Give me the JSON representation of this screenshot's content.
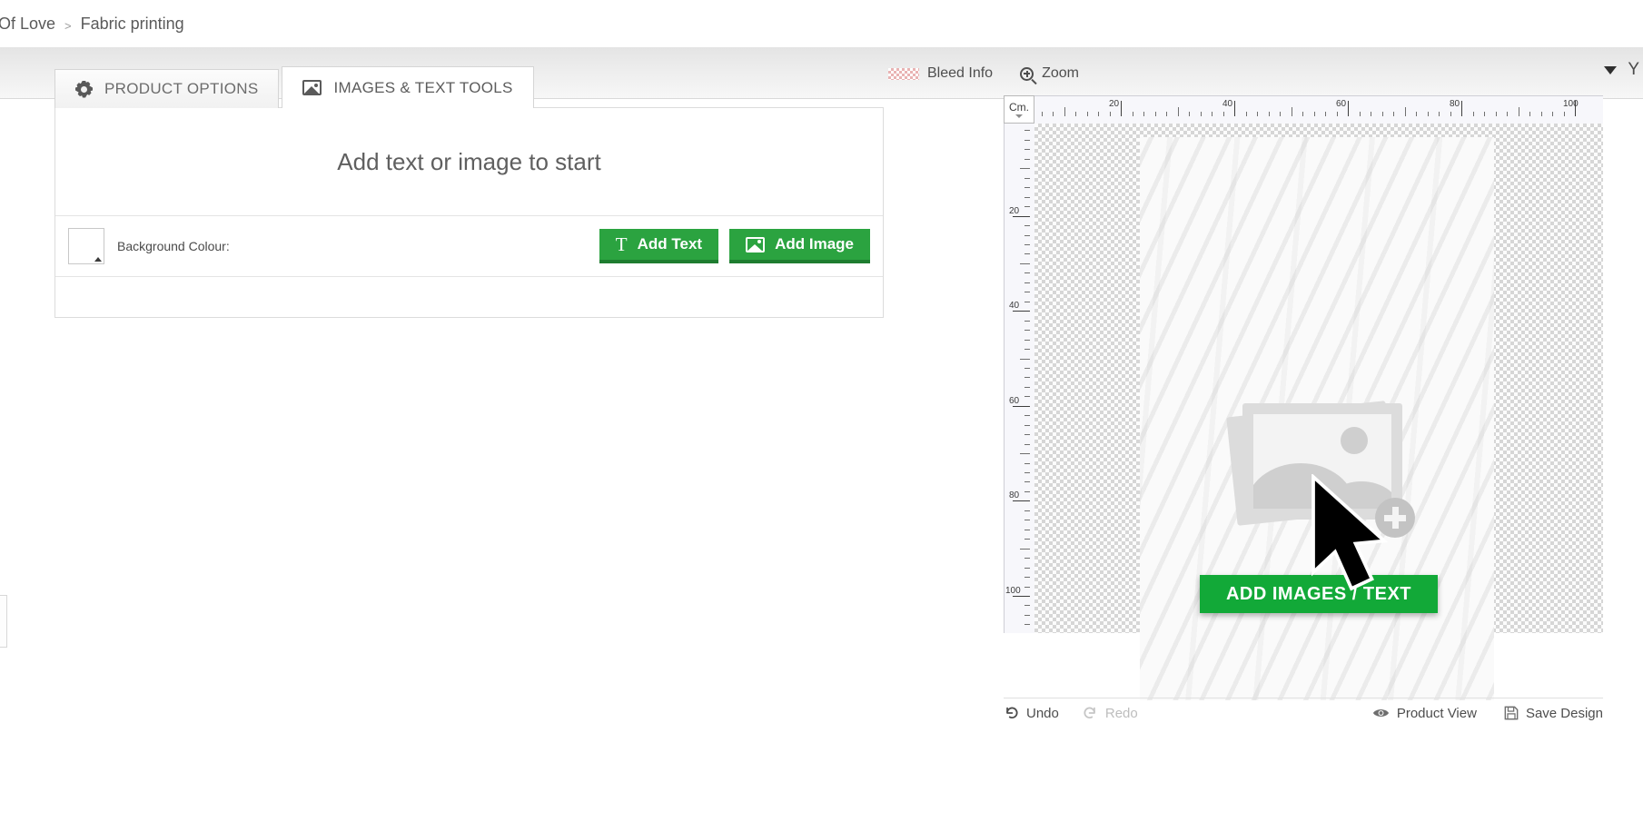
{
  "breadcrumb": {
    "items": [
      {
        "label": "s Of Love"
      },
      {
        "label": "Fabric printing"
      }
    ],
    "separator": ">"
  },
  "tabs": [
    {
      "label": "PRODUCT OPTIONS",
      "icon": "gear-icon",
      "active": false
    },
    {
      "label": "IMAGES & TEXT TOOLS",
      "icon": "picture-icon",
      "active": true
    }
  ],
  "editor_panel": {
    "hint": "Add text or image to start",
    "background_colour_label": "Background Colour:",
    "background_colour_value": "#ffffff",
    "buttons": [
      {
        "label": "Add Text",
        "icon": "text-T-icon"
      },
      {
        "label": "Add Image",
        "icon": "picture-icon"
      }
    ]
  },
  "right_tools": [
    {
      "label": "Bleed Info",
      "icon": "bleed-checker-swatch"
    },
    {
      "label": "Zoom",
      "icon": "magnifier-plus-icon"
    }
  ],
  "right_edge": {
    "caret": "collapse-caret-icon",
    "letter": "Y"
  },
  "stage": {
    "ruler_unit": "Cm.",
    "ruler_h_labels": [
      "20",
      "40",
      "60",
      "80"
    ],
    "ruler_v_labels": [
      "20",
      "40",
      "60",
      "80",
      "100"
    ],
    "canvas_cta": "ADD IMAGES / TEXT",
    "placeholder_icon": "image-stack-add-icon"
  },
  "stage_footer": {
    "left": [
      {
        "label": "Undo",
        "icon": "undo-arrow-icon",
        "disabled": false
      },
      {
        "label": "Redo",
        "icon": "redo-arrow-icon",
        "disabled": true
      }
    ],
    "right": [
      {
        "label": "Product View",
        "icon": "eye-icon"
      },
      {
        "label": "Save Design",
        "icon": "floppy-disk-icon"
      }
    ]
  },
  "colors": {
    "green_button": "#2ba340",
    "green_cta": "#12a938",
    "bleed_pink": "#e9b3b3"
  }
}
